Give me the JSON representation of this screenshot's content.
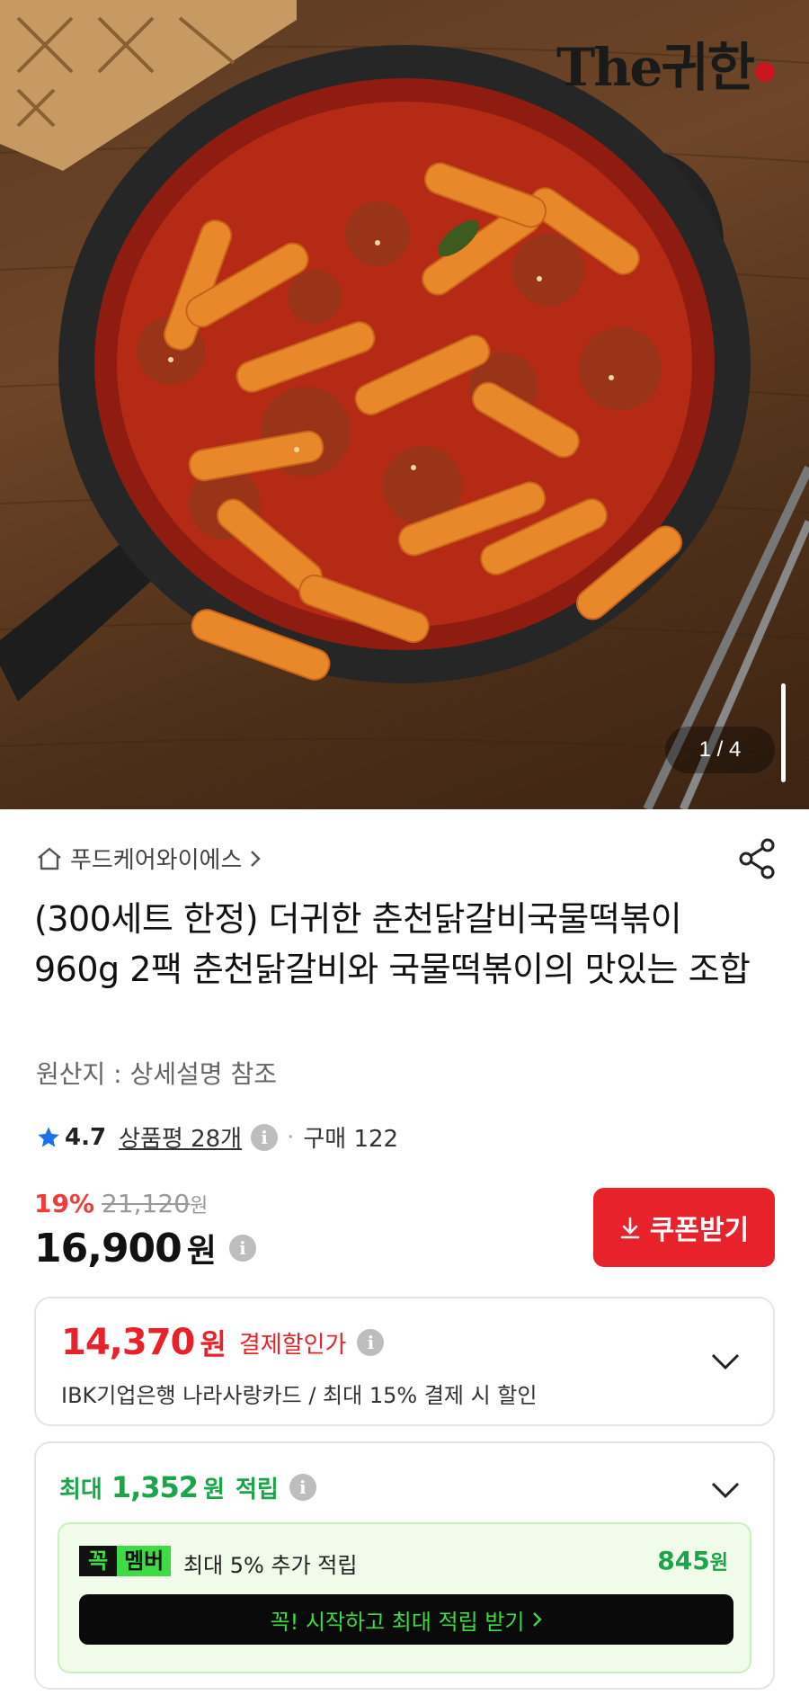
{
  "hero": {
    "brand": "The귀한",
    "pager": "1 / 4"
  },
  "seller": {
    "name": "푸드케어와이에스",
    "icons": [
      "home-icon",
      "chevron-right-icon"
    ],
    "share_icon": "share-icon"
  },
  "product": {
    "title": "(300세트 한정) 더귀한 춘천닭갈비국물떡볶이 960g 2팩 춘천닭갈비와 국물떡볶이의 맛있는 조합",
    "origin": "원산지 : 상세설명 참조"
  },
  "rating": {
    "score": "4.7",
    "reviews": "상품평 28개",
    "purchases": "구매 122"
  },
  "price": {
    "discount_pct": "19%",
    "original": "21,120",
    "original_unit": "원",
    "current": "16,900",
    "current_unit": "원",
    "coupon_label": "쿠폰받기"
  },
  "card_discount": {
    "price": "14,370",
    "unit": "원",
    "label": "결제할인가",
    "description": "IBK기업은행 나라사랑카드 / 최대 15% 결제 시 할인"
  },
  "points": {
    "prefix": "최대",
    "amount": "1,352",
    "unit": "원",
    "label": "적립",
    "member": {
      "tag_a": "꼭",
      "tag_b": "멤버",
      "text": "최대 5% 추가 적립",
      "amount": "845",
      "unit": "원",
      "cta": "꼭! 시작하고 최대 적립 받기"
    }
  },
  "colors": {
    "red": "#e8222a",
    "green": "#1ba54a",
    "member_green": "#3ddc44"
  }
}
